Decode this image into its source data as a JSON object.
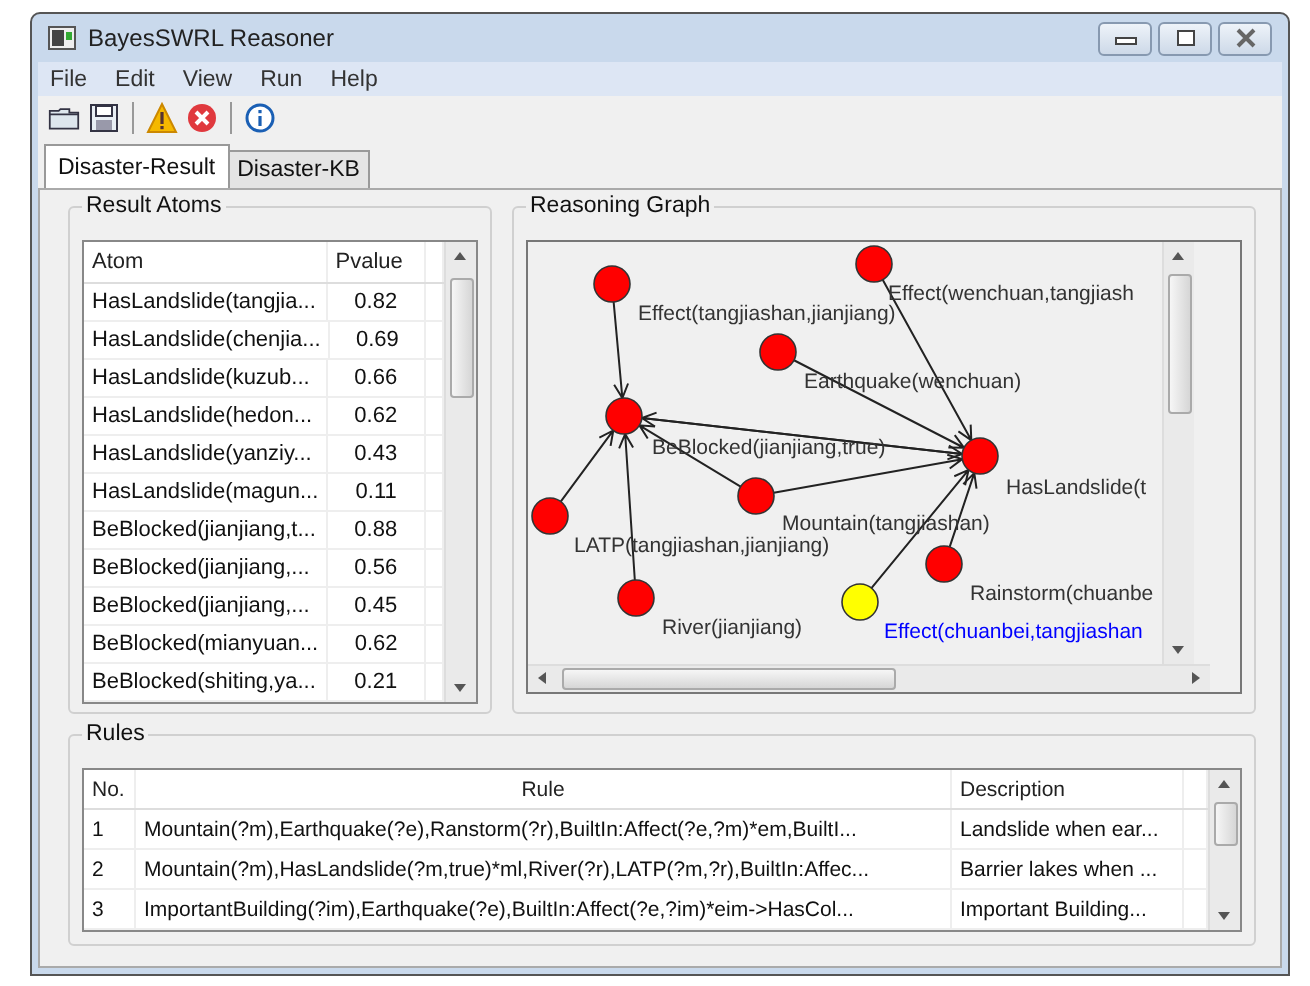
{
  "window": {
    "title": "BayesSWRL Reasoner"
  },
  "menu": [
    "File",
    "Edit",
    "View",
    "Run",
    "Help"
  ],
  "tabs": [
    {
      "label": "Disaster-Result",
      "selected": true
    },
    {
      "label": "Disaster-KB",
      "selected": false
    }
  ],
  "result_atoms": {
    "title": "Result Atoms",
    "columns": [
      "Atom",
      "Pvalue"
    ],
    "rows": [
      {
        "atom": "HasLandslide(tangjia...",
        "pvalue": "0.82"
      },
      {
        "atom": "HasLandslide(chenjia...",
        "pvalue": "0.69"
      },
      {
        "atom": "HasLandslide(kuzub...",
        "pvalue": "0.66"
      },
      {
        "atom": "HasLandslide(hedon...",
        "pvalue": "0.62"
      },
      {
        "atom": "HasLandslide(yanziy...",
        "pvalue": "0.43"
      },
      {
        "atom": "HasLandslide(magun...",
        "pvalue": "0.11"
      },
      {
        "atom": "BeBlocked(jianjiang,t...",
        "pvalue": "0.88"
      },
      {
        "atom": "BeBlocked(jianjiang,...",
        "pvalue": "0.56"
      },
      {
        "atom": "BeBlocked(jianjiang,...",
        "pvalue": "0.45"
      },
      {
        "atom": "BeBlocked(mianyuan...",
        "pvalue": "0.62"
      },
      {
        "atom": "BeBlocked(shiting,ya...",
        "pvalue": "0.21"
      }
    ]
  },
  "reasoning_graph": {
    "title": "Reasoning Graph",
    "nodes": [
      {
        "color": "#ff0000"
      },
      {
        "color": "#ff0000"
      },
      {
        "color": "#ff0000"
      },
      {
        "color": "#ff0000"
      },
      {
        "color": "#ff0000"
      },
      {
        "color": "#ff0000"
      },
      {
        "color": "#ff0000"
      },
      {
        "color": "#ff0000"
      },
      {
        "color": "#ff0000"
      },
      {
        "color": "#ffff00"
      }
    ],
    "labels": [
      {
        "text": "Effect(tangjiashan,jianjiang)",
        "color": "#333333"
      },
      {
        "text": "Effect(wenchuan,tangjiash",
        "color": "#333333"
      },
      {
        "text": "Earthquake(wenchuan)",
        "color": "#333333"
      },
      {
        "text": "BeBlocked(jianjiang,true)",
        "color": "#333333"
      },
      {
        "text": "HasLandslide(t",
        "color": "#333333"
      },
      {
        "text": "Mountain(tangjiashan)",
        "color": "#333333"
      },
      {
        "text": "LATP(tangjiashan,jianjiang)",
        "color": "#333333"
      },
      {
        "text": "Rainstorm(chuanbe",
        "color": "#333333"
      },
      {
        "text": "River(jianjiang)",
        "color": "#333333"
      },
      {
        "text": "Effect(chuanbei,tangjiashan",
        "color": "#0000ff"
      }
    ]
  },
  "rules": {
    "title": "Rules",
    "columns": [
      "No.",
      "Rule",
      "Description"
    ],
    "rows": [
      {
        "no": "1",
        "rule": "Mountain(?m),Earthquake(?e),Ranstorm(?r),BuiltIn:Affect(?e,?m)*em,BuiltI...",
        "description": "Landslide when ear..."
      },
      {
        "no": "2",
        "rule": "Mountain(?m),HasLandslide(?m,true)*ml,River(?r),LATP(?m,?r),BuiltIn:Affec...",
        "description": "Barrier lakes when ..."
      },
      {
        "no": "3",
        "rule": "ImportantBuilding(?im),Earthquake(?e),BuiltIn:Affect(?e,?im)*eim->HasCol...",
        "description": "Important Building..."
      }
    ]
  }
}
